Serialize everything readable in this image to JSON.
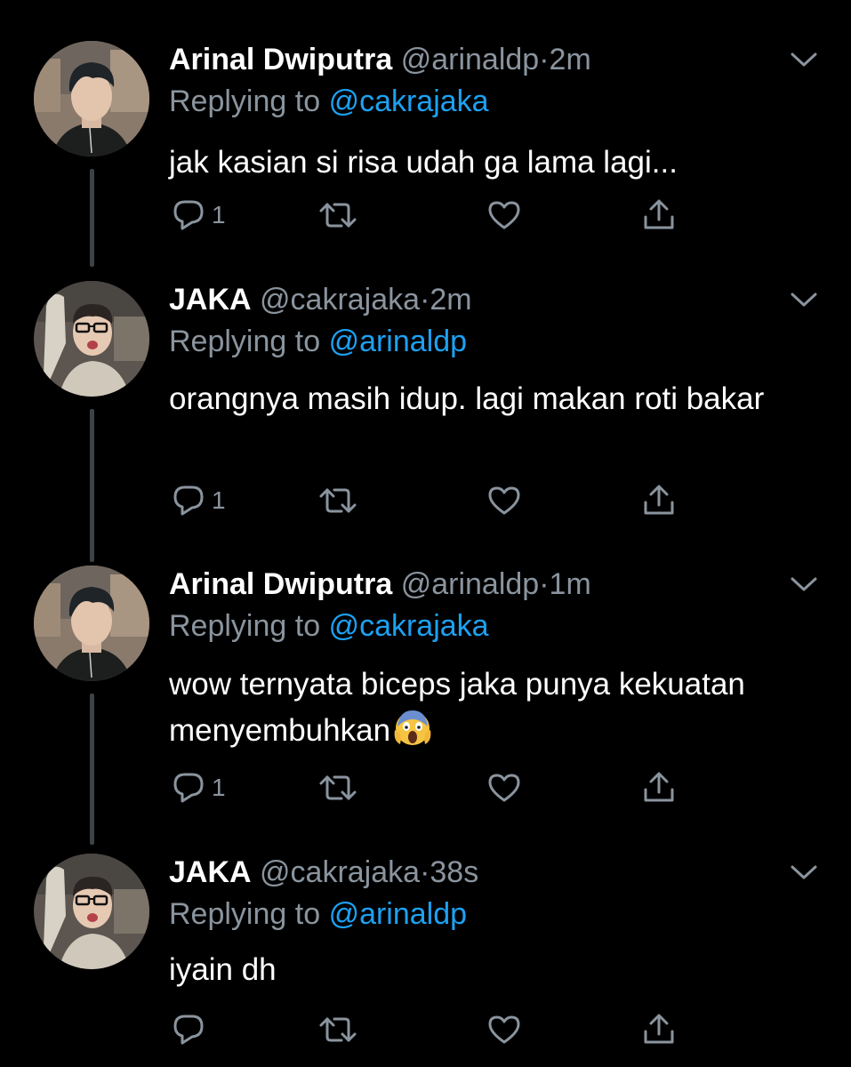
{
  "tweets": [
    {
      "display_name": "Arinal Dwiputra",
      "handle": "@arinaldp",
      "separator": "·",
      "time": "2m",
      "replying_prefix": "Replying to",
      "replying_to": "@cakrajaka",
      "text": "jak kasian si risa udah ga lama lagi...",
      "reply_count": "1",
      "avatar_icon": "profile-photo-arinal"
    },
    {
      "display_name": "JAKA",
      "handle": "@cakrajaka",
      "separator": "·",
      "time": "2m",
      "replying_prefix": "Replying to",
      "replying_to": "@arinaldp",
      "text": "orangnya masih idup. lagi makan roti bakar",
      "reply_count": "1",
      "avatar_icon": "profile-photo-jaka"
    },
    {
      "display_name": "Arinal Dwiputra",
      "handle": "@arinaldp",
      "separator": "·",
      "time": "1m",
      "replying_prefix": "Replying to",
      "replying_to": "@cakrajaka",
      "text": "wow ternyata biceps jaka punya kekuatan menyembuhkan",
      "emoji": "screaming-face-emoji",
      "reply_count": "1",
      "avatar_icon": "profile-photo-arinal"
    },
    {
      "display_name": "JAKA",
      "handle": "@cakrajaka",
      "separator": "·",
      "time": "38s",
      "replying_prefix": "Replying to",
      "replying_to": "@arinaldp",
      "text": "iyain dh",
      "reply_count": "",
      "avatar_icon": "profile-photo-jaka"
    }
  ],
  "icons": {
    "reply": "reply-icon",
    "retweet": "retweet-icon",
    "like": "heart-icon",
    "share": "share-icon",
    "menu": "chevron-down-icon"
  },
  "colors": {
    "background": "#000000",
    "primary_text": "#ffffff",
    "secondary_text": "#8a949e",
    "link": "#1da1f2",
    "thread_line": "#3d4246"
  }
}
